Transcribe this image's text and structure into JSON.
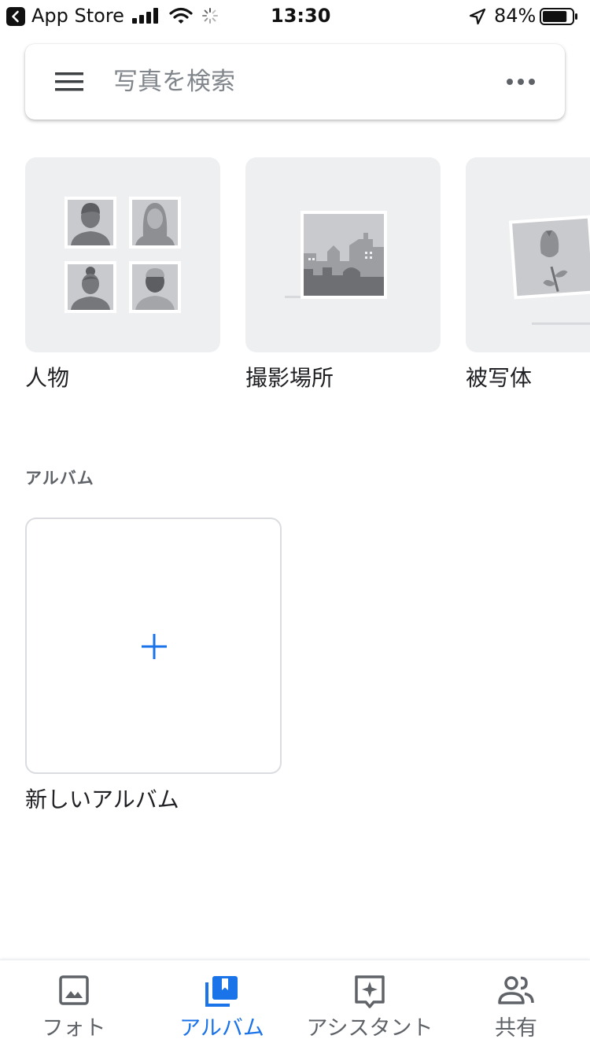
{
  "status_bar": {
    "back_label": "App Store",
    "time": "13:30",
    "battery_percent": "84%",
    "battery_level": 0.84
  },
  "search": {
    "placeholder": "写真を検索",
    "menu_icon": "hamburger-menu-icon",
    "more_icon": "more-horizontal-icon"
  },
  "explore": [
    {
      "label": "人物",
      "icon": "people-illustration"
    },
    {
      "label": "撮影場所",
      "icon": "places-illustration"
    },
    {
      "label": "被写体",
      "icon": "things-illustration"
    }
  ],
  "albums": {
    "section_title": "アルバム",
    "new_album_label": "新しいアルバム"
  },
  "bottom_nav": {
    "active_color": "#1a73e8",
    "items": [
      {
        "label": "フォト",
        "icon": "photo-icon"
      },
      {
        "label": "アルバム",
        "icon": "album-icon"
      },
      {
        "label": "アシスタント",
        "icon": "assistant-icon"
      },
      {
        "label": "共有",
        "icon": "sharing-icon"
      }
    ]
  }
}
